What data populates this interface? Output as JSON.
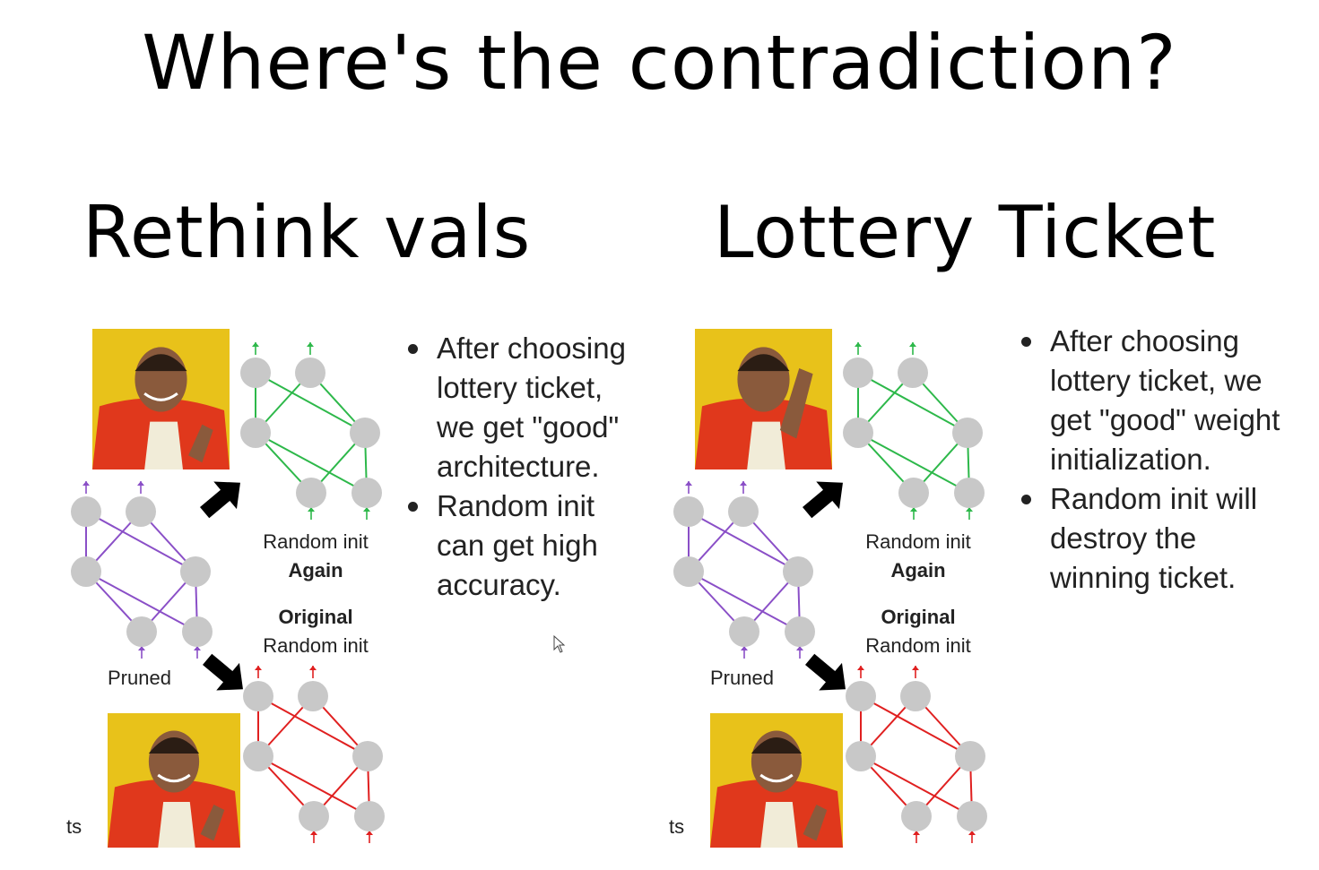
{
  "slide": {
    "title": "Where's the contradiction?"
  },
  "left": {
    "heading": "Rethink vals",
    "bullets": [
      "After choosing lottery ticket, we  get \"good\" architecture.",
      "Random init can get high accuracy."
    ],
    "diagram": {
      "meme_top": "approve",
      "meme_bottom": "approve",
      "label_random_init_1": "Random init",
      "label_again": "Again",
      "label_original": "Original",
      "label_random_init_2": "Random init",
      "label_pruned": "Pruned",
      "label_cut": "ts"
    }
  },
  "right": {
    "heading": "Lottery Ticket",
    "bullets": [
      "After choosing lottery ticket, we  get \"good\" weight initialization.",
      "Random init will destroy the winning ticket."
    ],
    "diagram": {
      "meme_top": "reject",
      "meme_bottom": "approve",
      "label_random_init_1": "Random init",
      "label_again": "Again",
      "label_original": "Original",
      "label_random_init_2": "Random init",
      "label_pruned": "Pruned",
      "label_cut": "ts"
    }
  },
  "colors": {
    "green": "#2db84a",
    "purple": "#8a4fc7",
    "red": "#e02020",
    "node": "#c8c8c8",
    "meme_bg": "#e8c21a",
    "jacket": "#e0381c"
  }
}
